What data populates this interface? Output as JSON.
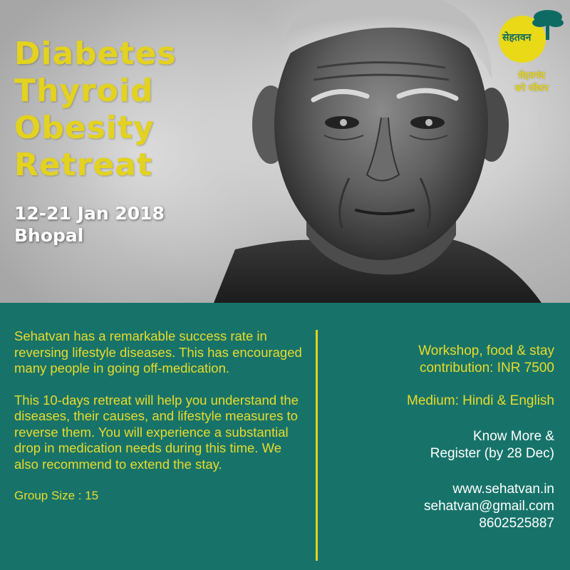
{
  "title_lines": [
    "Diabetes",
    "Thyroid",
    "Obesity",
    "Retreat"
  ],
  "dates": "12-21 Jan 2018",
  "location": "Bhopal",
  "logo": {
    "name": "सेहतवन",
    "tagline_line1": "सेहतमंद",
    "tagline_line2": "बने जीवन",
    "icon": "tree-icon"
  },
  "description": {
    "para1": "Sehatvan has a remarkable success rate in reversing lifestyle diseases. This has encouraged many people in going off-medication.",
    "para2": "This 10-days retreat will help you understand the diseases, their causes, and lifestyle measures to reverse them. You will experience a substantial drop in medication needs during this time. We also recommend to extend the stay.",
    "group_size": "Group Size : 15"
  },
  "details": {
    "contribution_line1": "Workshop, food & stay",
    "contribution_line2": "contribution:  INR 7500",
    "medium": "Medium: Hindi & English",
    "register_line1": "Know More &",
    "register_line2": "Register (by 28 Dec)",
    "website": "www.sehatvan.in",
    "email": "sehatvan@gmail.com",
    "phone": "8602525887"
  },
  "colors": {
    "accent_yellow": "#e3d21f",
    "teal": "#17736a",
    "white": "#ffffff"
  }
}
